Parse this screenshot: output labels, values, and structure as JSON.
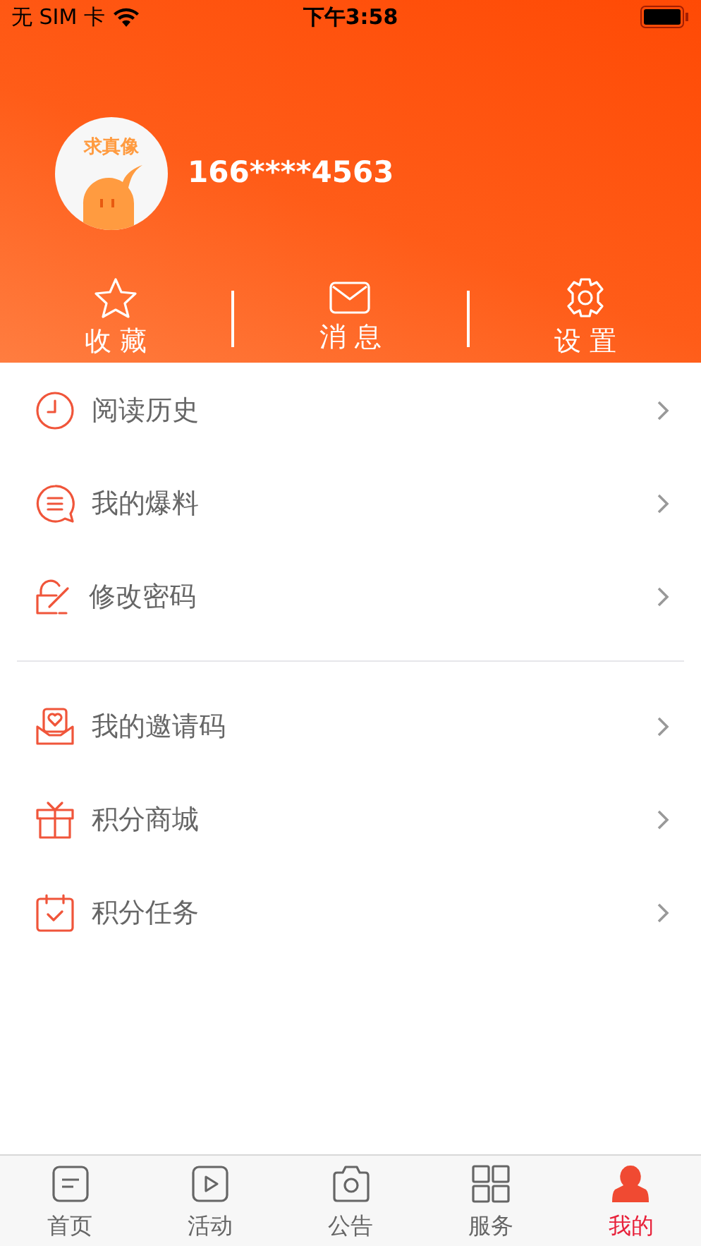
{
  "status_bar": {
    "carrier": "无 SIM 卡",
    "time": "下午3:58"
  },
  "profile": {
    "avatar_text": "求真像",
    "phone": "166****4563"
  },
  "quick_actions": [
    {
      "label": "收 藏"
    },
    {
      "label": "消 息"
    },
    {
      "label": "设 置"
    }
  ],
  "menu_groups": [
    {
      "items": [
        {
          "label": "阅读历史"
        },
        {
          "label": "我的爆料"
        },
        {
          "label": "修改密码"
        }
      ]
    },
    {
      "items": [
        {
          "label": "我的邀请码"
        },
        {
          "label": "积分商城"
        },
        {
          "label": "积分任务"
        }
      ]
    }
  ],
  "tab_bar": [
    {
      "label": "首页",
      "selected": false
    },
    {
      "label": "活动",
      "selected": false
    },
    {
      "label": "公告",
      "selected": false
    },
    {
      "label": "服务",
      "selected": false
    },
    {
      "label": "我的",
      "selected": true
    }
  ]
}
